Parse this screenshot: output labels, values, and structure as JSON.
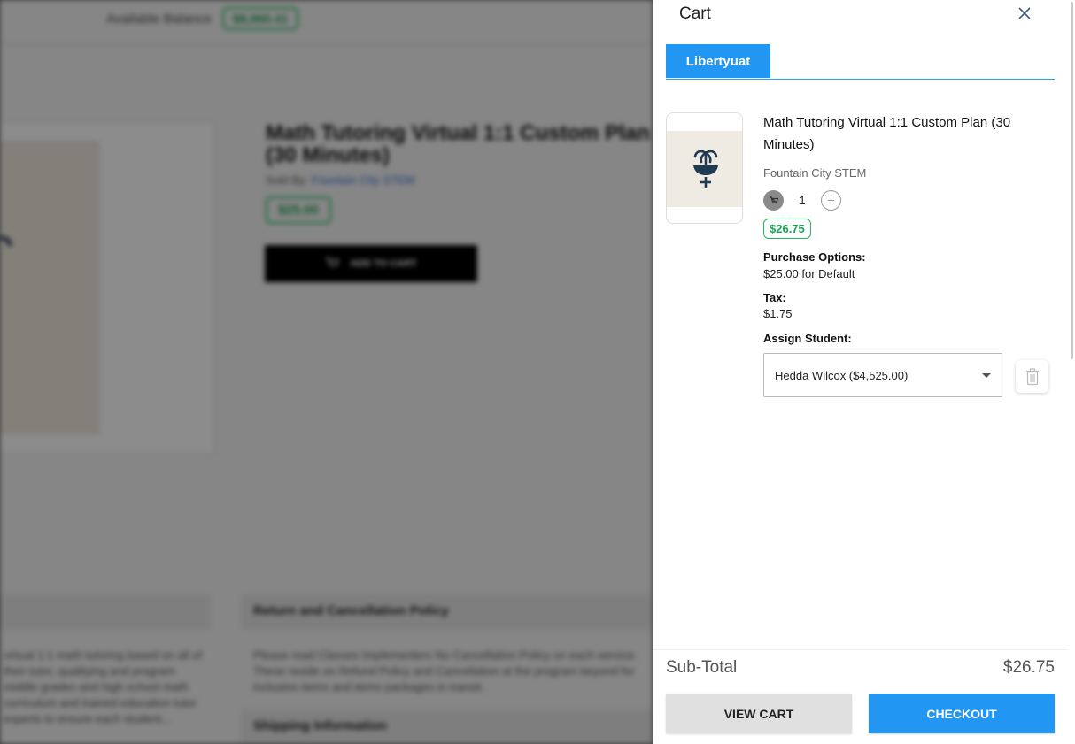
{
  "background": {
    "balance_label": "Available Balance",
    "balance_value": "$8,960.41",
    "product_title": "Math Tutoring Virtual 1:1 Custom Plan (30 Minutes)",
    "sold_by_label": "Sold By:",
    "sold_by_vendor": "Fountain City STEM",
    "price": "$25.00",
    "add_to_cart_label": "ADD TO CART",
    "description_snippet": "virtual 1:1 math tutoring based on all of their tutor, qualitying and program middle grades and high school math curriculum and trained education tutor experts to ensure each student...",
    "policy_heading": "Return and Cancellation Policy",
    "policy_text": "Please read Classes Implementers No Cancellation Policy on each service. These reside on Refund Policy and Cancellation at the program beyond for inclusion items and items packages in transit.",
    "policy_link_1": "No Cancellation Policy",
    "policy_link_2": "Refund Policy",
    "shipping_heading": "Shipping Information"
  },
  "cart": {
    "title": "Cart",
    "close_icon": "close-icon",
    "tabs": [
      {
        "label": "Libertyuat",
        "active": true
      }
    ],
    "items": [
      {
        "name": "Math Tutoring Virtual 1:1 Custom Plan (30 Minutes)",
        "seller": "Fountain City STEM",
        "quantity": "1",
        "price": "$26.75",
        "purchase_options_label": "Purchase Options:",
        "purchase_options_value": "$25.00 for Default",
        "tax_label": "Tax:",
        "tax_value": "$1.75",
        "assign_student_label": "Assign Student:",
        "assigned_student": "Hedda Wilcox ($4,525.00)",
        "thumbnail_icon": "fountain-icon"
      }
    ],
    "subtotal_label": "Sub-Total",
    "subtotal_value": "$26.75",
    "view_cart_label": "VIEW CART",
    "checkout_label": "CHECKOUT"
  },
  "colors": {
    "accent": "#2196f3",
    "price_green": "#1aa554",
    "icon_navy": "#1f3a52"
  }
}
